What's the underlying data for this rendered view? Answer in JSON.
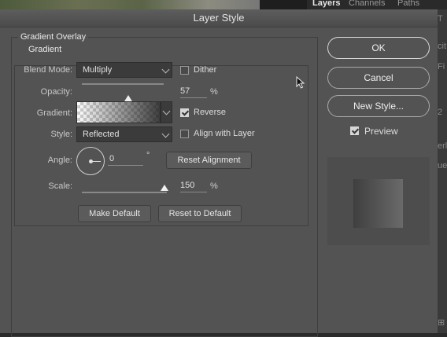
{
  "background": {
    "panel_tabs": [
      "Layers",
      "Channels",
      "Paths"
    ],
    "right_strip_glyphs": [
      "T",
      "cit",
      "Fi",
      "2",
      "erl",
      "ue/",
      "⊞"
    ]
  },
  "dialog": {
    "title": "Layer Style",
    "section_title": "Gradient Overlay",
    "group_title": "Gradient",
    "blend_mode": {
      "label": "Blend Mode:",
      "value": "Multiply"
    },
    "dither": {
      "label": "Dither",
      "checked": false
    },
    "opacity": {
      "label": "Opacity:",
      "value": "57",
      "unit": "%"
    },
    "gradient": {
      "label": "Gradient:"
    },
    "reverse": {
      "label": "Reverse",
      "checked": true
    },
    "style": {
      "label": "Style:",
      "value": "Reflected"
    },
    "align_with_layer": {
      "label": "Align with Layer",
      "checked": false
    },
    "angle": {
      "label": "Angle:",
      "value": "0",
      "unit": "°"
    },
    "reset_alignment": "Reset Alignment",
    "scale": {
      "label": "Scale:",
      "value": "150",
      "unit": "%"
    },
    "make_default": "Make Default",
    "reset_to_default": "Reset to Default"
  },
  "actions": {
    "ok": "OK",
    "cancel": "Cancel",
    "new_style": "New Style...",
    "preview": {
      "label": "Preview",
      "checked": true
    }
  },
  "colors": {
    "dialog_bg": "#535353",
    "preview_swatch_start": "#3f3f3f",
    "preview_swatch_end": "#6a6a6a"
  }
}
